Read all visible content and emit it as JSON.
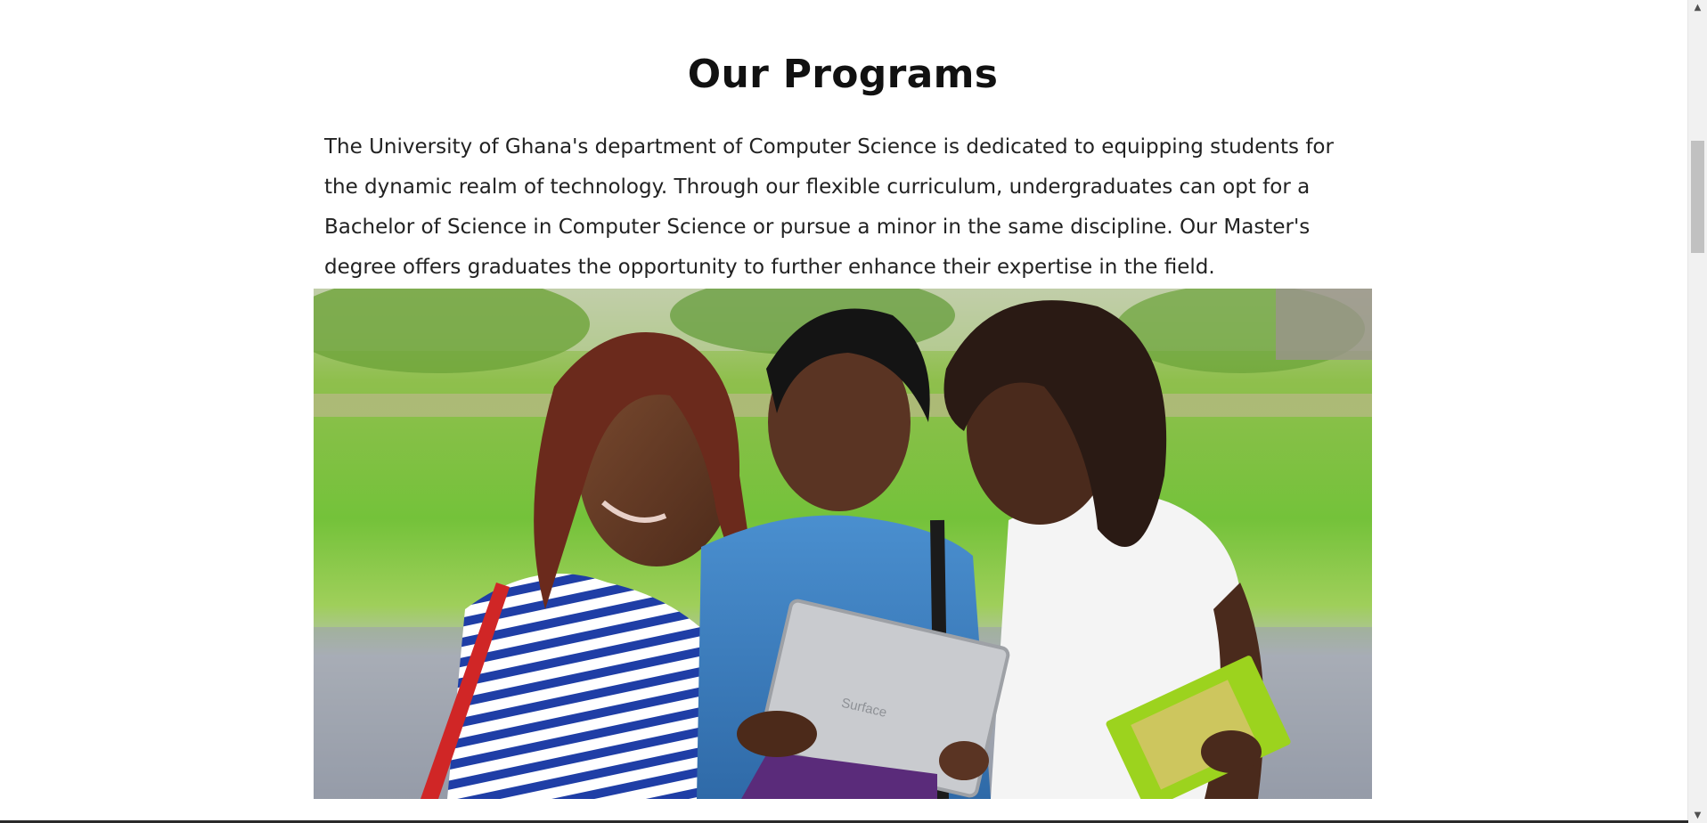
{
  "programs": {
    "title": "Our Programs",
    "description": "The University of Ghana's department of Computer Science is dedicated to equipping students for the dynamic realm of technology. Through our flexible curriculum, undergraduates can opt for a Bachelor of Science in Computer Science or pursue a minor in the same discipline. Our Master's degree offers graduates the opportunity to further enhance their expertise in the field.",
    "image": {
      "tablet_brand": "Surface"
    }
  },
  "icons": {
    "scroll_up": "chevron-up-icon",
    "scroll_down": "chevron-down-icon"
  }
}
